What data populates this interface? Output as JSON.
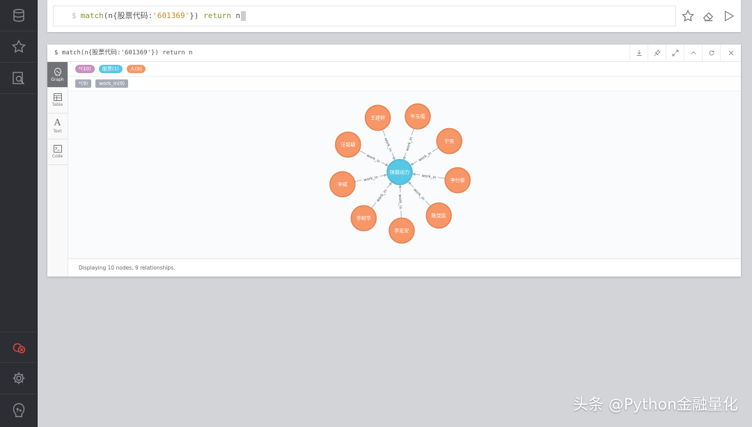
{
  "sidebar": {
    "top_items": [
      {
        "name": "database-icon"
      },
      {
        "name": "star-icon"
      },
      {
        "name": "document-search-icon"
      }
    ],
    "bottom_items": [
      {
        "name": "connection-off-icon",
        "color": "#e0483c"
      },
      {
        "name": "gear-icon"
      },
      {
        "name": "neo4j-logo-icon"
      }
    ]
  },
  "editor": {
    "prompt": "$",
    "query_keyword": "match",
    "query_pre": "(n{股票代码:",
    "query_string": "'601369'",
    "query_post": "})",
    "query_return": "return",
    "query_var": "n",
    "buttons": [
      "favorite-star-icon",
      "eraser-icon",
      "run-play-icon"
    ]
  },
  "frame": {
    "title": "$ match(n{股票代码:'601369'}) return n",
    "header_buttons": [
      "download-icon",
      "pin-icon",
      "expand-icon",
      "collapse-icon",
      "refresh-icon",
      "close-icon"
    ],
    "views": [
      {
        "label": "Graph",
        "icon": "graph-icon",
        "active": true
      },
      {
        "label": "Table",
        "icon": "table-icon",
        "active": false
      },
      {
        "label": "Text",
        "icon": "text-icon",
        "active": false
      },
      {
        "label": "Code",
        "icon": "code-icon",
        "active": false
      }
    ],
    "node_labels": [
      {
        "text": "*(10)",
        "color": "#c990c0"
      },
      {
        "text": "股票(1)",
        "color": "#57c7e3"
      },
      {
        "text": "人(9)",
        "color": "#f79767"
      }
    ],
    "rel_types": [
      {
        "text": "*(9)"
      },
      {
        "text": "work_in(9)"
      }
    ],
    "graph": {
      "center": {
        "label": "陕鼓动力",
        "color": "#57c7e3",
        "stroke": "#4ab5d0"
      },
      "person_color": "#f79767",
      "person_stroke": "#e3804d",
      "rel_label": "work_in",
      "people": [
        "王建轩",
        "牛东儒",
        "宁奕",
        "李付俊",
        "陈党民",
        "李宏安",
        "李树华",
        "李成",
        "汪韬颖"
      ]
    },
    "footer": "Displaying 10 nodes, 9 relationships."
  },
  "watermark": "头条 @Python金融量化"
}
